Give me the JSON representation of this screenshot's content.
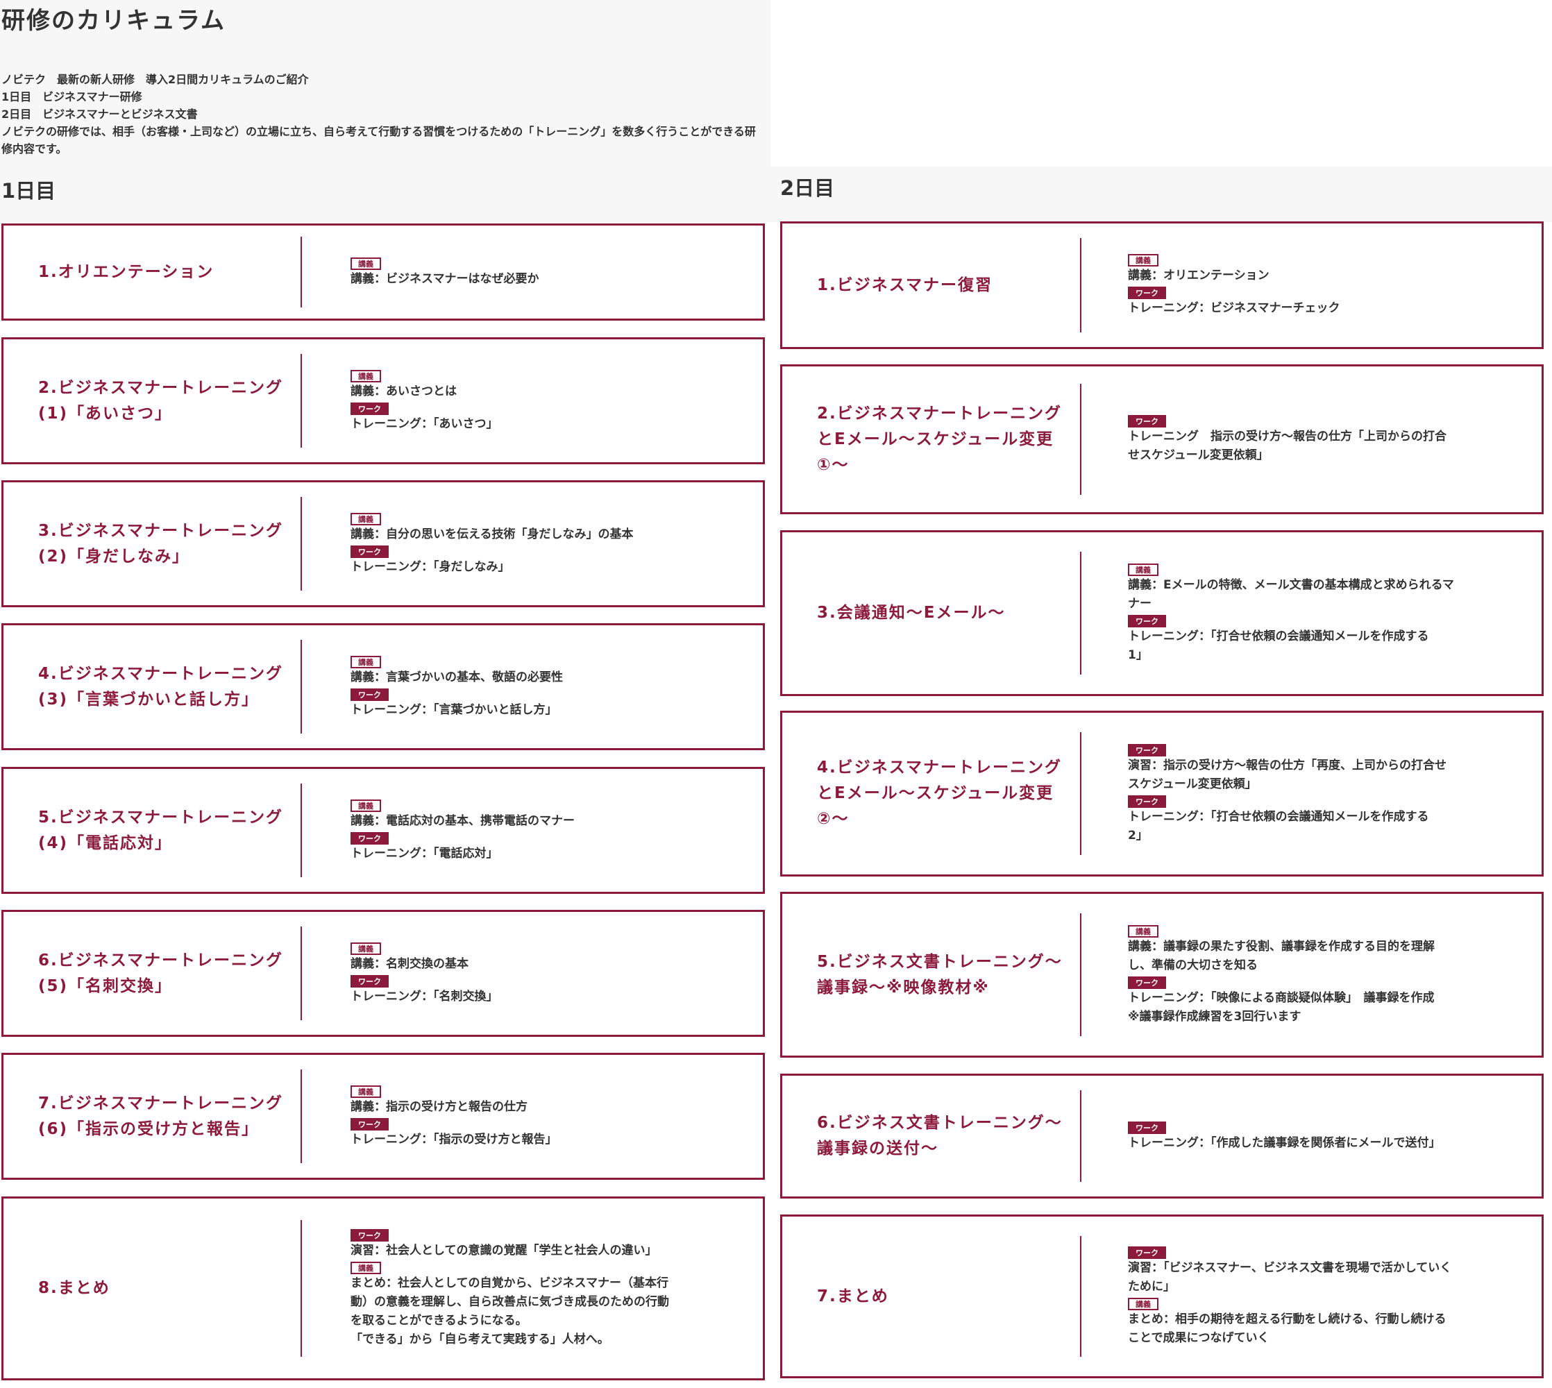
{
  "page": {
    "title": "研修のカリキュラム",
    "intro": [
      "ノビテク　最新の新人研修　導入2日間カリキュラムのご紹介",
      "1日目　ビジネスマナー研修",
      "2日目　ビジネスマナーとビジネス文書",
      "ノビテクの研修では、相手（お客様・上司など）の立場に立ち、自ら考えて行動する習慣をつけるための「トレーニング」を数多く行うことができる研修内容です。"
    ]
  },
  "badges": {
    "lecture": "講義",
    "work": "ワーク"
  },
  "day1": {
    "heading": "1日目",
    "sessions": [
      {
        "title": [
          "1.オリエンテーション"
        ],
        "items": [
          {
            "badge": "lecture",
            "lines": [
              "講義：ビジネスマナーはなぜ必要か"
            ]
          }
        ]
      },
      {
        "title": [
          "2.ビジネスマナートレーニング",
          "(1)「あいさつ」"
        ],
        "items": [
          {
            "badge": "lecture",
            "lines": [
              "講義：あいさつとは"
            ]
          },
          {
            "badge": "work",
            "lines": [
              "トレーニング：「あいさつ」"
            ]
          }
        ]
      },
      {
        "title": [
          "3.ビジネスマナートレーニング",
          "(2)「身だしなみ」"
        ],
        "items": [
          {
            "badge": "lecture",
            "lines": [
              "講義：自分の思いを伝える技術「身だしなみ」の基本"
            ]
          },
          {
            "badge": "work",
            "lines": [
              "トレーニング：「身だしなみ」"
            ]
          }
        ]
      },
      {
        "title": [
          "4.ビジネスマナートレーニング",
          "(3)「言葉づかいと話し方」"
        ],
        "items": [
          {
            "badge": "lecture",
            "lines": [
              "講義：言葉づかいの基本、敬語の必要性"
            ]
          },
          {
            "badge": "work",
            "lines": [
              "トレーニング：「言葉づかいと話し方」"
            ]
          }
        ]
      },
      {
        "title": [
          "5.ビジネスマナートレーニング",
          "(4)「電話応対」"
        ],
        "items": [
          {
            "badge": "lecture",
            "lines": [
              "講義：電話応対の基本、携帯電話のマナー"
            ]
          },
          {
            "badge": "work",
            "lines": [
              "トレーニング：「電話応対」"
            ]
          }
        ]
      },
      {
        "title": [
          "6.ビジネスマナートレーニング",
          "(5)「名刺交換」"
        ],
        "items": [
          {
            "badge": "lecture",
            "lines": [
              "講義：名刺交換の基本"
            ]
          },
          {
            "badge": "work",
            "lines": [
              "トレーニング：「名刺交換」"
            ]
          }
        ]
      },
      {
        "title": [
          "7.ビジネスマナートレーニング",
          "(6)「指示の受け方と報告」"
        ],
        "items": [
          {
            "badge": "lecture",
            "lines": [
              "講義：指示の受け方と報告の仕方"
            ]
          },
          {
            "badge": "work",
            "lines": [
              "トレーニング：「指示の受け方と報告」"
            ]
          }
        ]
      },
      {
        "title": [
          "8.まとめ"
        ],
        "items": [
          {
            "badge": "work",
            "lines": [
              "演習：社会人としての意識の覚醒「学生と社会人の違い」"
            ]
          },
          {
            "badge": "lecture",
            "lines": [
              "まとめ：社会人としての自覚から、ビジネスマナー（基本行",
              "動）の意義を理解し、自ら改善点に気づき成長のための行動",
              "を取ることができるようになる。",
              "「できる」から「自ら考えて実践する」人材へ。"
            ]
          }
        ]
      }
    ]
  },
  "day2": {
    "heading": "2日目",
    "sessions": [
      {
        "title": [
          "1.ビジネスマナー復習"
        ],
        "items": [
          {
            "badge": "lecture",
            "lines": [
              "講義：オリエンテーション"
            ]
          },
          {
            "badge": "work",
            "lines": [
              "トレーニング：ビジネスマナーチェック"
            ]
          }
        ]
      },
      {
        "title": [
          "2.ビジネスマナートレーニング",
          "とEメール～スケジュール変更",
          "①～"
        ],
        "items": [
          {
            "badge": "work",
            "lines": [
              "トレーニング　指示の受け方～報告の仕方「上司からの打合",
              "せスケジュール変更依頼」"
            ]
          }
        ]
      },
      {
        "title": [
          "3.会議通知～Eメール～"
        ],
        "items": [
          {
            "badge": "lecture",
            "lines": [
              "講義：Eメールの特徴、メール文書の基本構成と求められるマ",
              "ナー"
            ]
          },
          {
            "badge": "work",
            "lines": [
              "トレーニング：「打合せ依頼の会議通知メールを作成する",
              "1」"
            ]
          }
        ]
      },
      {
        "title": [
          "4.ビジネスマナートレーニング",
          "とEメール～スケジュール変更",
          "②～"
        ],
        "items": [
          {
            "badge": "work",
            "lines": [
              "演習：指示の受け方～報告の仕方「再度、上司からの打合せ",
              "スケジュール変更依頼」"
            ]
          },
          {
            "badge": "work",
            "lines": [
              "トレーニング：「打合せ依頼の会議通知メールを作成する",
              "2」"
            ]
          }
        ]
      },
      {
        "title": [
          "5.ビジネス文書トレーニング～",
          "議事録～※映像教材※"
        ],
        "items": [
          {
            "badge": "lecture",
            "lines": [
              "講義：議事録の果たす役割、議事録を作成する目的を理解",
              "し、準備の大切さを知る"
            ]
          },
          {
            "badge": "work",
            "lines": [
              "トレーニング：「映像による商談疑似体験」　議事録を作成",
              "※議事録作成練習を3回行います"
            ]
          }
        ]
      },
      {
        "title": [
          "6.ビジネス文書トレーニング～",
          "議事録の送付～"
        ],
        "items": [
          {
            "badge": "work",
            "lines": [
              "トレーニング：「作成した議事録を関係者にメールで送付」"
            ]
          }
        ]
      },
      {
        "title": [
          "7.まとめ"
        ],
        "items": [
          {
            "badge": "work",
            "lines": [
              "演習：「ビジネスマナー、ビジネス文書を現場で活かしていく",
              "ために」"
            ]
          },
          {
            "badge": "lecture",
            "lines": [
              "まとめ：相手の期待を超える行動をし続ける、行動し続ける",
              "ことで成果につなげていく"
            ]
          }
        ]
      }
    ]
  }
}
